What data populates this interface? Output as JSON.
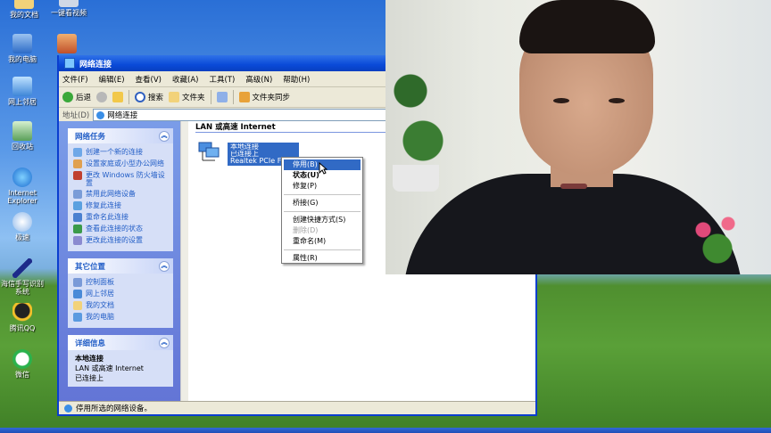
{
  "desktop": {
    "icons": [
      {
        "label": "我的文档",
        "name": "my-documents-icon"
      },
      {
        "label": "我的电脑",
        "name": "my-computer-icon"
      },
      {
        "label": "网上邻居",
        "name": "network-places-icon"
      },
      {
        "label": "回收站",
        "name": "recycle-bin-icon"
      },
      {
        "label": "Internet Explorer",
        "name": "internet-explorer-icon"
      },
      {
        "label": "极速",
        "name": "browser-icon"
      },
      {
        "label": "海信手写识别系统",
        "name": "handwriting-icon"
      },
      {
        "label": "腾讯QQ",
        "name": "qq-icon"
      },
      {
        "label": "微信",
        "name": "wechat-icon"
      }
    ],
    "top_icon_label": "一键看视频"
  },
  "window": {
    "title": "网络连接",
    "menu": [
      "文件(F)",
      "编辑(E)",
      "查看(V)",
      "收藏(A)",
      "工具(T)",
      "高级(N)",
      "帮助(H)"
    ],
    "toolbar": {
      "back": "后退",
      "search": "搜索",
      "folders": "文件夹",
      "folder_sync": "文件夹同步"
    },
    "address": {
      "label": "地址(D)",
      "value": "网络连接"
    },
    "status_text": "停用所选的网络设备。"
  },
  "task_pane": {
    "network_tasks": {
      "title": "网络任务",
      "items": [
        "创建一个新的连接",
        "设置家庭或小型办公网络",
        "更改 Windows 防火墙设置",
        "禁用此网络设备",
        "修复此连接",
        "重命名此连接",
        "查看此连接的状态",
        "更改此连接的设置"
      ]
    },
    "other_places": {
      "title": "其它位置",
      "items": [
        "控制面板",
        "网上邻居",
        "我的文档",
        "我的电脑"
      ]
    },
    "details": {
      "title": "详细信息",
      "name": "本地连接",
      "type": "LAN 或高速 Internet",
      "status": "已连接上"
    }
  },
  "content": {
    "group_header": "LAN 或高速 Internet",
    "connection": {
      "name": "本地连接",
      "status": "已连接上",
      "device": "Realtek PCIe FE"
    }
  },
  "context_menu": {
    "items": [
      {
        "label": "停用(B)",
        "state": "selected"
      },
      {
        "label": "状态(U)",
        "state": "bold"
      },
      {
        "label": "修复(P)",
        "state": "normal"
      },
      {
        "label": "桥接(G)",
        "state": "normal"
      },
      {
        "label": "创建快捷方式(S)",
        "state": "normal"
      },
      {
        "label": "删除(D)",
        "state": "disabled"
      },
      {
        "label": "重命名(M)",
        "state": "normal"
      },
      {
        "label": "属性(R)",
        "state": "normal"
      }
    ]
  },
  "colors": {
    "selection": "#316ac5",
    "task_link": "#215dc6",
    "title_bar": "#0a4ad8"
  }
}
